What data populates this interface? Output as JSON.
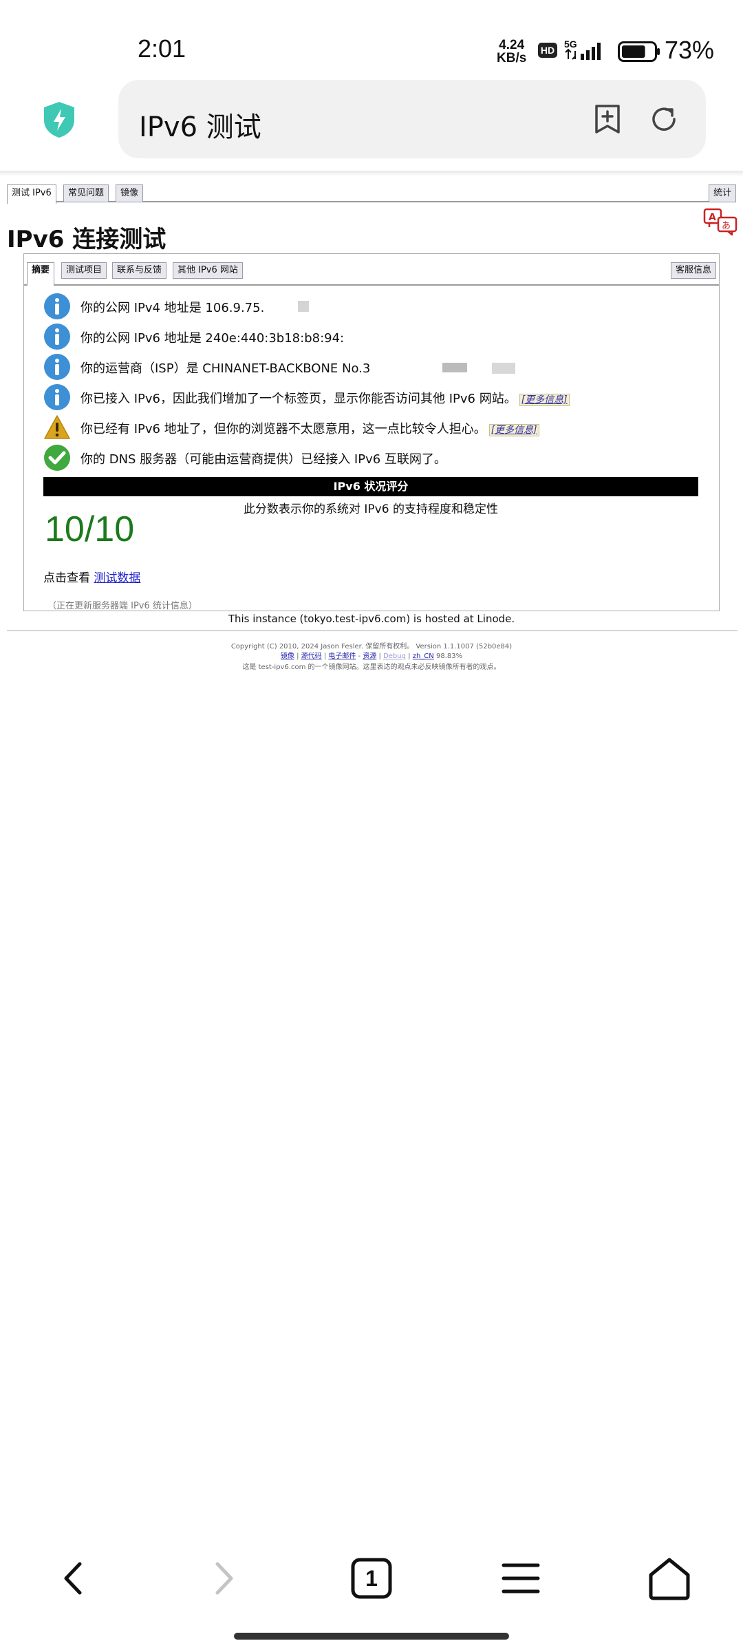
{
  "status_bar": {
    "time": "2:01",
    "net_speed": "4.24",
    "net_unit": "KB/s",
    "hd_label": "HD",
    "network_type": "5G",
    "battery_percent": "73%",
    "battery_level": 0.73
  },
  "browser": {
    "url_title": "IPv6 测试",
    "accent_color": "#3fc8b4"
  },
  "site": {
    "top_tabs": [
      "测试 IPv6",
      "常见问题",
      "镜像"
    ],
    "stats_tab": "统计",
    "title": "IPv6 连接测试",
    "panel_tabs": [
      "摘要",
      "测试项目",
      "联系与反馈",
      "其他 IPv6 网站"
    ],
    "service_tab": "客服信息",
    "results": [
      {
        "icon": "info",
        "text": "你的公网 IPv4 地址是 106.9.75."
      },
      {
        "icon": "info",
        "text": "你的公网 IPv6 地址是 240e:440:3b18:b8:94:"
      },
      {
        "icon": "info",
        "text": "你的运营商（ISP）是 CHINANET-BACKBONE No.3"
      },
      {
        "icon": "info",
        "text": "你已接入 IPv6，因此我们增加了一个标签页，显示你能否访问其他 IPv6 网站。",
        "link": "[更多信息]"
      },
      {
        "icon": "warning",
        "text": "你已经有 IPv6 地址了，但你的浏览器不太愿意用，这一点比较令人担心。",
        "link": "[更多信息]"
      },
      {
        "icon": "ok",
        "text": "你的 DNS 服务器（可能由运营商提供）已经接入 IPv6 互联网了。"
      }
    ],
    "score_header": "IPv6 状况评分",
    "score_description": "此分数表示你的系统对 IPv6 的支持程度和稳定性",
    "score": "10/10",
    "click_prefix": "点击查看",
    "test_data_link": "测试数据",
    "updating_note": "（正在更新服务器端 IPv6 统计信息）",
    "hosted_line": "This instance (tokyo.test-ipv6.com) is hosted at Linode.",
    "footer_copyright": "Copyright (C) 2010, 2024 Jason Fesler. 保留所有权利。 Version 1.1.1007 (52b0e84)",
    "footer_links": [
      "镜像",
      "源代码",
      "电子邮件",
      "资源",
      "Debug",
      "zh_CN"
    ],
    "footer_locale_pct": "98.83%",
    "footer_disclaimer": "这是 test-ipv6.com 的一个镜像网站。这里表达的观点未必反映镜像所有者的观点。"
  },
  "nav": {
    "tab_count": "1"
  }
}
